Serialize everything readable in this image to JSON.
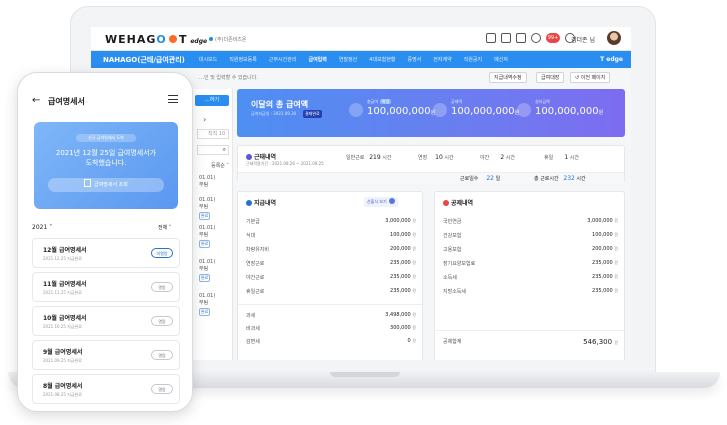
{
  "desktop": {
    "brand": {
      "logo_prefix": "WEHAG",
      "logo_o": "O",
      "product": "edge",
      "company": "(주)더존비즈온"
    },
    "user": {
      "name": "김더존 님"
    },
    "badge_count": "99+",
    "menu": {
      "title": "NAHAGO(근태/급여관리)",
      "items": [
        "대시보드",
        "직원정보등록",
        "근무시간관리",
        "급여입력",
        "연말정산",
        "4대보험현황",
        "증명서",
        "전자계약",
        "직원공지",
        "메신저"
      ],
      "active_index": 3,
      "right": "T edge"
    },
    "subbar": {
      "desc": "…인 및 입력할 수 있습니다.",
      "buttons": [
        "지급내역수정",
        "급여대장",
        "이전 페이지"
      ]
    },
    "left": {
      "button": "…하기",
      "search_value": "직직 10",
      "sort": "등록순",
      "rows": [
        {
          "line1": "01.01)",
          "line2": "무팀",
          "tag": ""
        },
        {
          "line1": "01.01)",
          "line2": "무팀",
          "tag": "완료"
        },
        {
          "line1": "01.01)",
          "line2": "무팀",
          "tag": "완료"
        },
        {
          "line1": "01.01)",
          "line2": "무팀",
          "tag": "완료"
        },
        {
          "line1": "01.01)",
          "line2": "무팀",
          "tag": "완료"
        }
      ]
    },
    "hero": {
      "title": "이달의 총 급여액",
      "subtitle": "급여지급일 : 2021.09.30",
      "status": "결재완료",
      "stats": [
        {
          "label": "총급여",
          "chip": "확정",
          "value": "100,000,000",
          "unit": "원"
        },
        {
          "label": "공제액",
          "chip": "",
          "value": "100,000,000",
          "unit": "원"
        },
        {
          "label": "실지급액",
          "chip": "",
          "value": "100,000,000",
          "unit": "원"
        }
      ]
    },
    "work": {
      "title": "근태내역",
      "period": "근태적용기간 : 2021.08.26 ~ 2021.09.25",
      "cells": [
        {
          "label": "일반근로",
          "value": "219",
          "unit": "시간"
        },
        {
          "label": "연장",
          "value": "10",
          "unit": "시간"
        },
        {
          "label": "야간",
          "value": "2",
          "unit": "시간"
        },
        {
          "label": "휴일",
          "value": "1",
          "unit": "시간"
        }
      ],
      "footer": {
        "days_label": "근로일수",
        "days_value": "22",
        "days_unit": "일",
        "hours_label": "총 근로시간",
        "hours_value": "232",
        "hours_unit": "시간"
      }
    },
    "pay": {
      "title": "지급내역",
      "calc_button": "산출식 보기",
      "rows": [
        {
          "label": "기본급",
          "value": "3,000,000"
        },
        {
          "label": "식대",
          "value": "100,000"
        },
        {
          "label": "차량유지비",
          "value": "200,000"
        },
        {
          "label": "연장근로",
          "value": "235,000"
        },
        {
          "label": "야간근로",
          "value": "235,000"
        },
        {
          "label": "휴일근로",
          "value": "235,000"
        }
      ],
      "totals": [
        {
          "label": "과세",
          "value": "3,498,000"
        },
        {
          "label": "비과세",
          "value": "300,000"
        },
        {
          "label": "감면세",
          "value": "0"
        }
      ],
      "unit": "원"
    },
    "deduction": {
      "title": "공제내역",
      "rows": [
        {
          "label": "국민연금",
          "value": "3,000,000"
        },
        {
          "label": "건강보험",
          "value": "100,000"
        },
        {
          "label": "고용보험",
          "value": "200,000"
        },
        {
          "label": "장기요양보험료",
          "value": "235,000"
        },
        {
          "label": "소득세",
          "value": "235,000"
        },
        {
          "label": "지방소득세",
          "value": "235,000"
        }
      ],
      "totals": [
        {
          "label": "공제합계",
          "value": "546,300"
        }
      ],
      "unit": "원"
    }
  },
  "mobile": {
    "title": "급여명세서",
    "card": {
      "chip": "신규 급여명세서 도착",
      "line1": "2021년 12월 25일 급여명세서가",
      "line2": "도착했습니다.",
      "button": "급여명세서 조회"
    },
    "year": "2021",
    "filter": "전체",
    "items": [
      {
        "title": "12월 급여명세서",
        "date": "2021.12.25 지급완료",
        "status": "미열람"
      },
      {
        "title": "11월 급여명세서",
        "date": "2021.11.25 지급완료",
        "status": "열람"
      },
      {
        "title": "10월 급여명세서",
        "date": "2021.10.25 지급완료",
        "status": "열람"
      },
      {
        "title": "9월 급여명세서",
        "date": "2021.09.25 지급완료",
        "status": "열람"
      },
      {
        "title": "8월 급여명세서",
        "date": "2021.08.25 지급완료",
        "status": "열람"
      }
    ]
  }
}
